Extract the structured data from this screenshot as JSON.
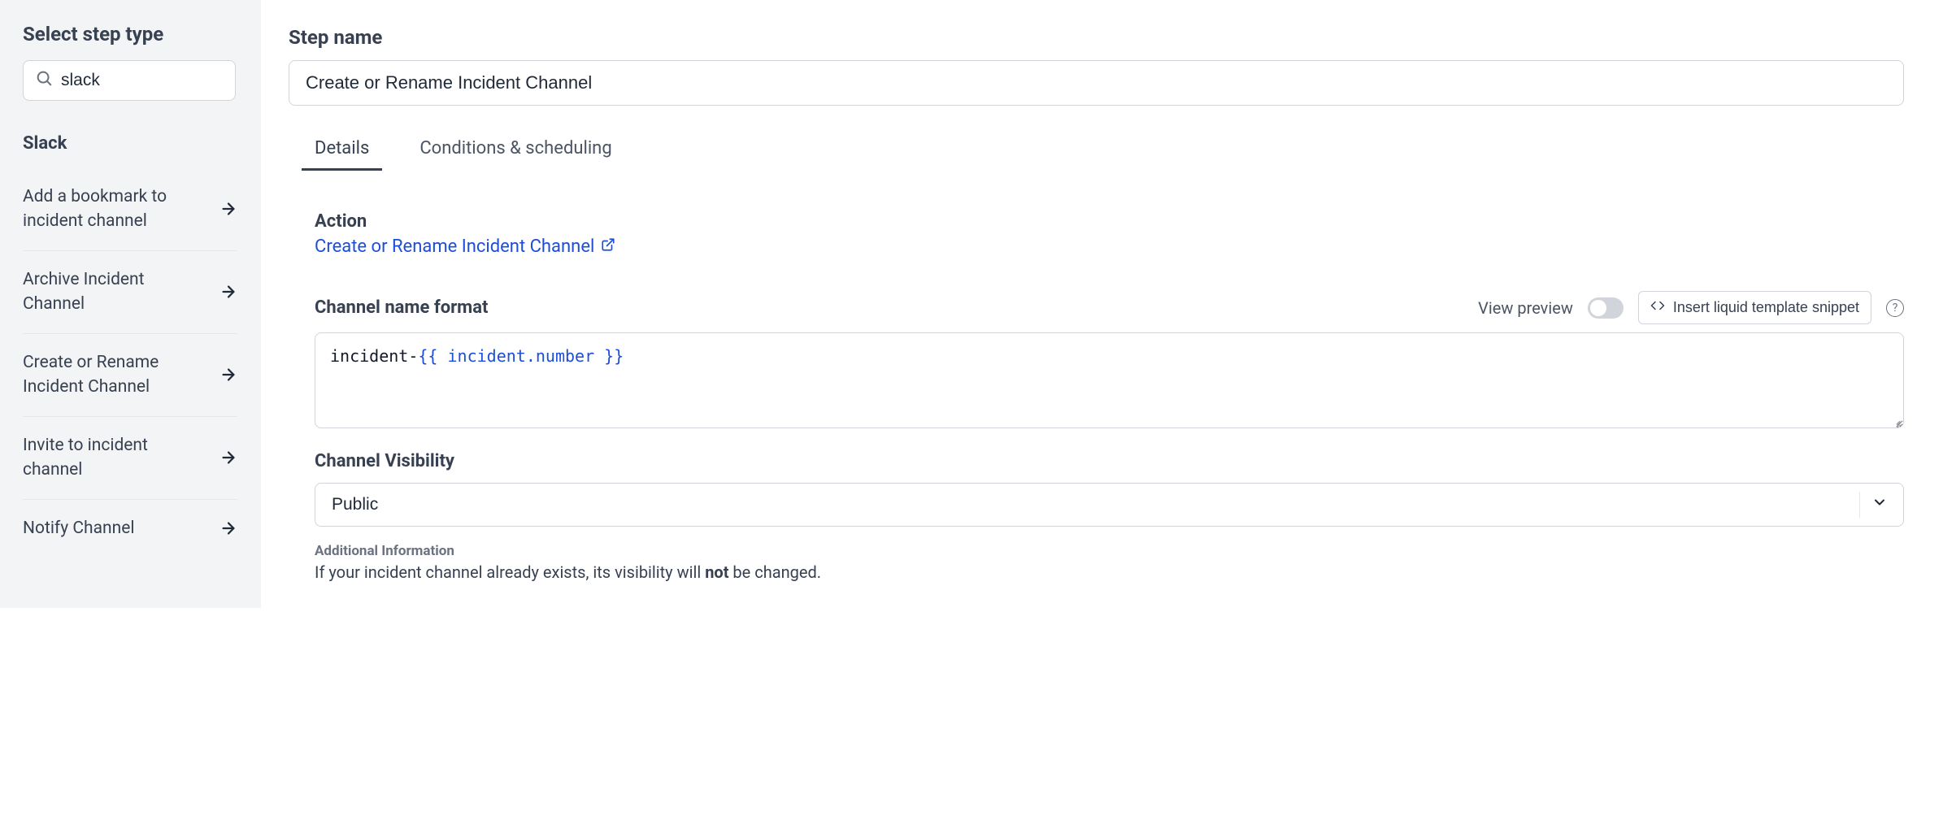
{
  "sidebar": {
    "title": "Select step type",
    "search_value": "slack",
    "group_label": "Slack",
    "items": [
      {
        "label": "Add a bookmark to incident channel"
      },
      {
        "label": "Archive Incident Channel"
      },
      {
        "label": "Create or Rename Incident Channel"
      },
      {
        "label": "Invite to incident channel"
      },
      {
        "label": "Notify Channel"
      }
    ]
  },
  "main": {
    "step_name_label": "Step name",
    "step_name_value": "Create or Rename Incident Channel",
    "tabs": [
      {
        "label": "Details",
        "active": true
      },
      {
        "label": "Conditions & scheduling",
        "active": false
      }
    ],
    "action": {
      "label": "Action",
      "link_text": "Create or Rename Incident Channel"
    },
    "channel_format": {
      "label": "Channel name format",
      "preview_label": "View preview",
      "snippet_button": "Insert liquid template snippet",
      "code_plain": "incident-",
      "code_liquid": "{{ incident.number }}"
    },
    "visibility": {
      "label": "Channel Visibility",
      "value": "Public"
    },
    "additional": {
      "header": "Additional Information",
      "body_pre": "If your incident channel already exists, its visibility will ",
      "body_bold": "not",
      "body_post": " be changed."
    }
  }
}
